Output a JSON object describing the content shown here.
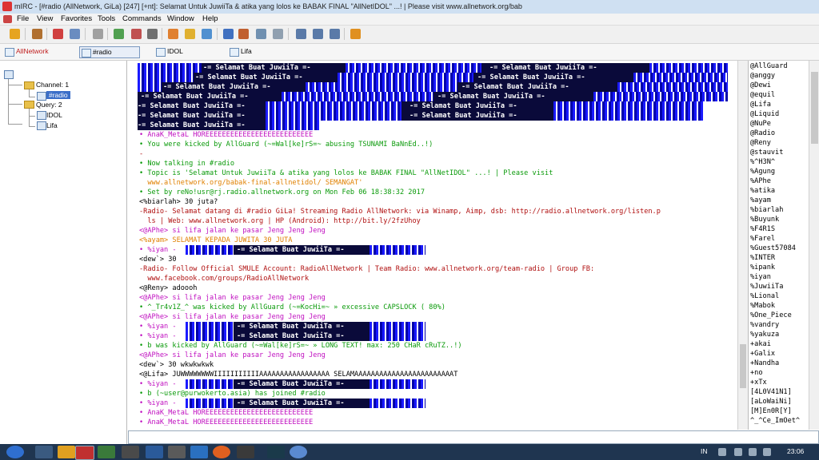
{
  "window": {
    "title": "mIRC - [#radio (AllNetwork, GiLa) [247] [+nt]: Selamat Untuk JuwiiTa & atika yang lolos ke BABAK FINAL \"AllNetIDOL\" ...! | Please visit www.allnetwork.org/bab"
  },
  "menu": [
    "File",
    "View",
    "Favorites",
    "Tools",
    "Commands",
    "Window",
    "Help"
  ],
  "switchbar": [
    {
      "label": "AllNetwork",
      "icon": "network-icon"
    },
    {
      "label": "#radio",
      "icon": "channel-icon"
    },
    {
      "label": "IDOL",
      "icon": "query-icon"
    },
    {
      "label": "Lifa",
      "icon": "query-icon"
    }
  ],
  "tree": {
    "network": "AllNetwork",
    "channels_label": "Channel: 1",
    "channel": "#radio",
    "queries_label": "Query: 2",
    "queries": [
      "IDOL",
      "Lifa"
    ]
  },
  "ascii_text": "-= Selamat Buat JuwiiTa =-",
  "chat_lines": [
    {
      "t": "• AnaK_MetaL HOREEEEEEEEEEEEEEEEEEEEEEEEEE",
      "c": "magenta"
    },
    {
      "t": "• You were kicked by AllGuard (~=Wal[ke]rS=~ abusing TSUNAMI BaNnEd..!)",
      "c": "green"
    },
    {
      "t": "-",
      "c": "red"
    },
    {
      "t": "• Now talking in #radio",
      "c": "green"
    },
    {
      "t": "• Topic is 'Selamat Untuk JuwiiTa & atika yang lolos ke BABAK FINAL \"AllNetIDOL\" ...! | Please visit",
      "c": "green"
    },
    {
      "t": "  www.allnetwork.org/babak-final-allnetidol/ SEMANGAT'",
      "c": "orange"
    },
    {
      "t": "• Set by reNo!usr@rj.radio.allnetwork.org on Mon Feb 06 18:38:32 2017",
      "c": "green"
    },
    {
      "t": "<%biarlah> 30 juta?",
      "c": "black"
    },
    {
      "t": "-Radio- Selamat datang di #radio GiLa! Streaming Radio AllNetwork: via Winamp, Aimp, dsb: http://radio.allnetwork.org/listen.p",
      "c": "red"
    },
    {
      "t": "  ls | Web: www.allnetwork.org | HP (Android): http://bit.ly/2fzUhoy",
      "c": "red"
    },
    {
      "t": "<@APhe> si lifa jalan ke pasar Jeng Jeng Jeng",
      "c": "magenta"
    },
    {
      "t": "<%ayam> SELAMAT KEPADA JUWITA 30 JUTA",
      "c": "orange"
    },
    {
      "t": "• %iyan -",
      "c": "magenta"
    },
    {
      "t": "<dew`> 30",
      "c": "black"
    },
    {
      "t": "-Radio- Follow Official SMULE Account: RadioAllNetwork | Team Radio: www.allnetwork.org/team-radio | Group FB:",
      "c": "red"
    },
    {
      "t": "  www.facebook.com/groups/RadioAllNetwork",
      "c": "red"
    },
    {
      "t": "<@Reny> adoooh",
      "c": "black"
    },
    {
      "t": "<@APhe> si lifa jalan ke pasar Jeng Jeng Jeng",
      "c": "magenta"
    },
    {
      "t": "• ^_Tr4v1Z_^ was kicked by AllGuard (~=KocHi=~ » excessive CAPSLOCK ( 80%)",
      "c": "green"
    },
    {
      "t": "<@APhe> si lifa jalan ke pasar Jeng Jeng Jeng",
      "c": "magenta"
    },
    {
      "t": "• %iyan -",
      "c": "magenta"
    },
    {
      "t": "• %iyan -",
      "c": "magenta"
    },
    {
      "t": "• b was kicked by AllGuard (~=Wal[ke]rS=~ » LONG TEXT! max: 250 CHaR cRuTZ..!)",
      "c": "green"
    },
    {
      "t": "<@APhe> si lifa jalan ke pasar Jeng Jeng Jeng",
      "c": "magenta"
    },
    {
      "t": "<dew`> 30 wkwkwkwk",
      "c": "black"
    },
    {
      "t": "<@Lifa> JUWWWWWWWWIIIIIIIIIIIAAAAAAAAAAAAAAAAA SELAMAAAAAAAAAAAAAAAAAAAAAAAAT",
      "c": "black"
    },
    {
      "t": "• %iyan -",
      "c": "magenta"
    },
    {
      "t": "• b (~user@purwokerto.asia) has joined #radio",
      "c": "green"
    },
    {
      "t": "• %iyan -",
      "c": "magenta"
    },
    {
      "t": "• AnaK_MetaL HOREEEEEEEEEEEEEEEEEEEEEEEEEE",
      "c": "magenta"
    },
    {
      "t": "• AnaK_MetaL HOREEEEEEEEEEEEEEEEEEEEEEEEEE",
      "c": "magenta"
    }
  ],
  "nicks": [
    "@AllGuard",
    "@anggy",
    "@Dewi",
    "@equil",
    "@Lifa",
    "@Liquid",
    "@NuPe",
    "@Radio",
    "@Reny",
    "@stauvit",
    "%^H3N^",
    "%Agung",
    "%APhe",
    "%atika",
    "%ayam",
    "%biarlah",
    "%Buyunk",
    "%F4R1S",
    "%Farel",
    "%Guest57084",
    "%INTER",
    "%ipank",
    "%iyan",
    "%JuwiiTa",
    "%Lional",
    "%Mabok",
    "%One_Piece",
    "%vandry",
    "%yakuza",
    "+akai",
    "+Galix",
    "+Nandha",
    "+no",
    "+xTx",
    "[4L0V41N1]",
    "[aLoWaiNi]",
    "[M]En0R[Y]",
    "^_^Ce_ImOet^"
  ],
  "tray": {
    "lang": "IN",
    "time": "23:06"
  }
}
